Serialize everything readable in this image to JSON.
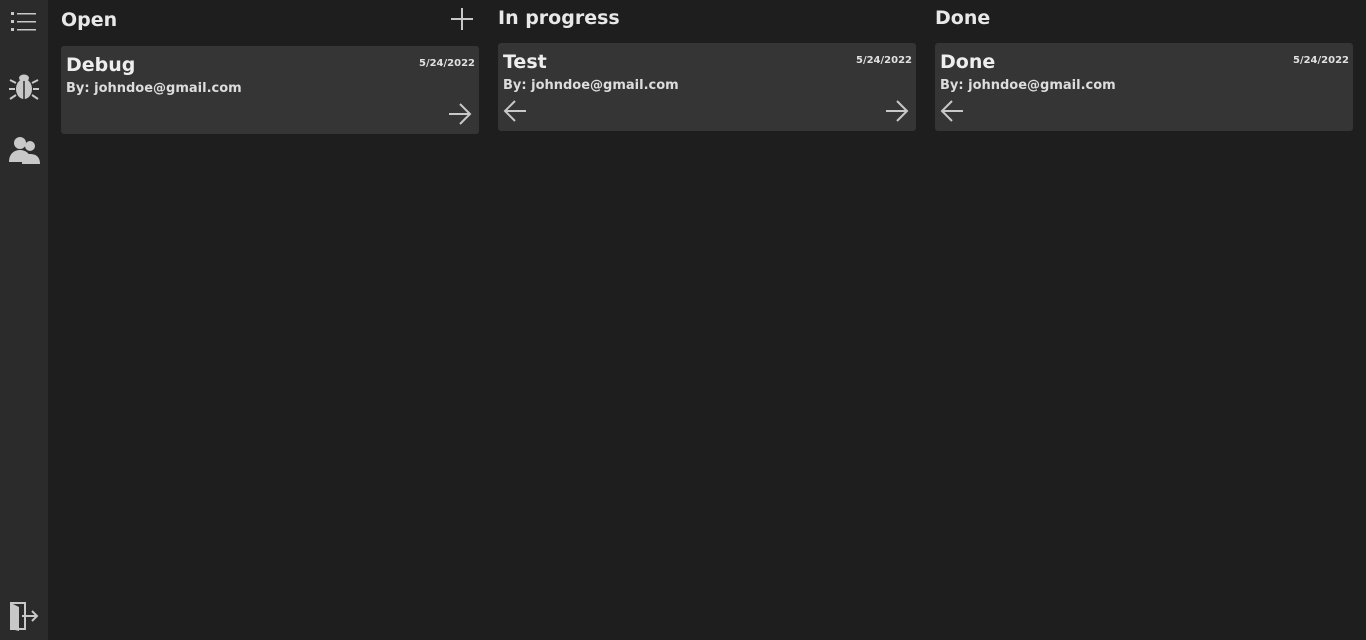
{
  "sidebar": {
    "items": [
      {
        "icon": "list-icon"
      },
      {
        "icon": "bug-icon"
      },
      {
        "icon": "users-icon"
      },
      {
        "icon": "logout-icon"
      }
    ]
  },
  "columns": [
    {
      "title": "Open",
      "cards": [
        {
          "title": "Debug",
          "date": "5/24/2022",
          "author": "By: johndoe@gmail.com"
        }
      ]
    },
    {
      "title": "In progress",
      "cards": [
        {
          "title": "Test",
          "date": "5/24/2022",
          "author": "By: johndoe@gmail.com"
        }
      ]
    },
    {
      "title": "Done",
      "cards": [
        {
          "title": "Done",
          "date": "5/24/2022",
          "author": "By: johndoe@gmail.com"
        }
      ]
    }
  ],
  "colors": {
    "background": "#1e1e1e",
    "sidebar": "#2b2b2b",
    "card": "#353535",
    "icon": "#c8c8c8"
  }
}
